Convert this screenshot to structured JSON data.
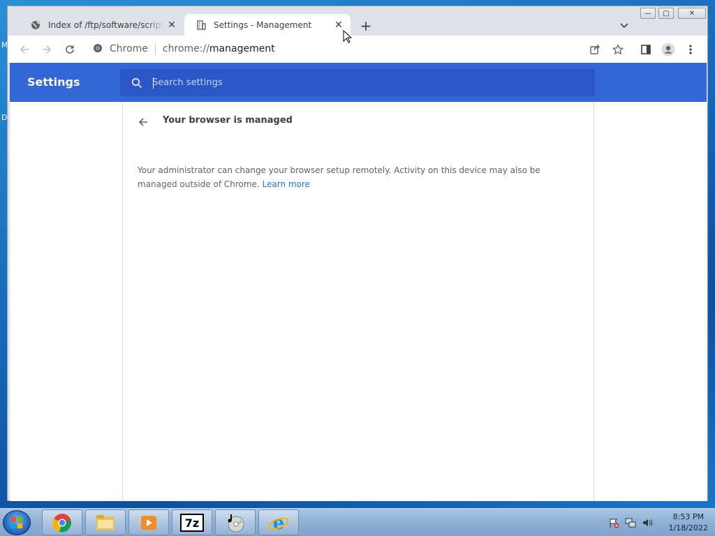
{
  "desktop": {
    "fragments": [
      "M",
      "D"
    ]
  },
  "browser": {
    "tabs": [
      {
        "title": "Index of /ftp/software/scripts/de",
        "icon": "globe-icon",
        "active": false
      },
      {
        "title": "Settings - Management",
        "icon": "building-icon",
        "active": true
      }
    ],
    "new_tab": "+",
    "window_controls": {
      "minimize": "—",
      "maximize": "□",
      "close": "✕"
    },
    "omnibox": {
      "chip": "Chrome",
      "url_scheme": "chrome://",
      "url_host": "management"
    }
  },
  "settings": {
    "title": "Settings",
    "search": {
      "placeholder": "Search settings"
    },
    "page_title": "Your browser is managed",
    "description": "Your administrator can change your browser setup remotely. Activity on this device may also be managed outside of Chrome.",
    "learn_more": "Learn more"
  },
  "taskbar": {
    "apps": [
      "chrome-icon",
      "explorer-icon",
      "media-player-icon",
      "7zip-icon",
      "cd-burner-icon",
      "internet-explorer-icon"
    ],
    "app_7z_label": "7z",
    "clock": {
      "time": "8:53 PM",
      "date": "1/18/2022"
    }
  },
  "colors": {
    "settings_header": "#3367d6",
    "link": "#1a73e8"
  }
}
